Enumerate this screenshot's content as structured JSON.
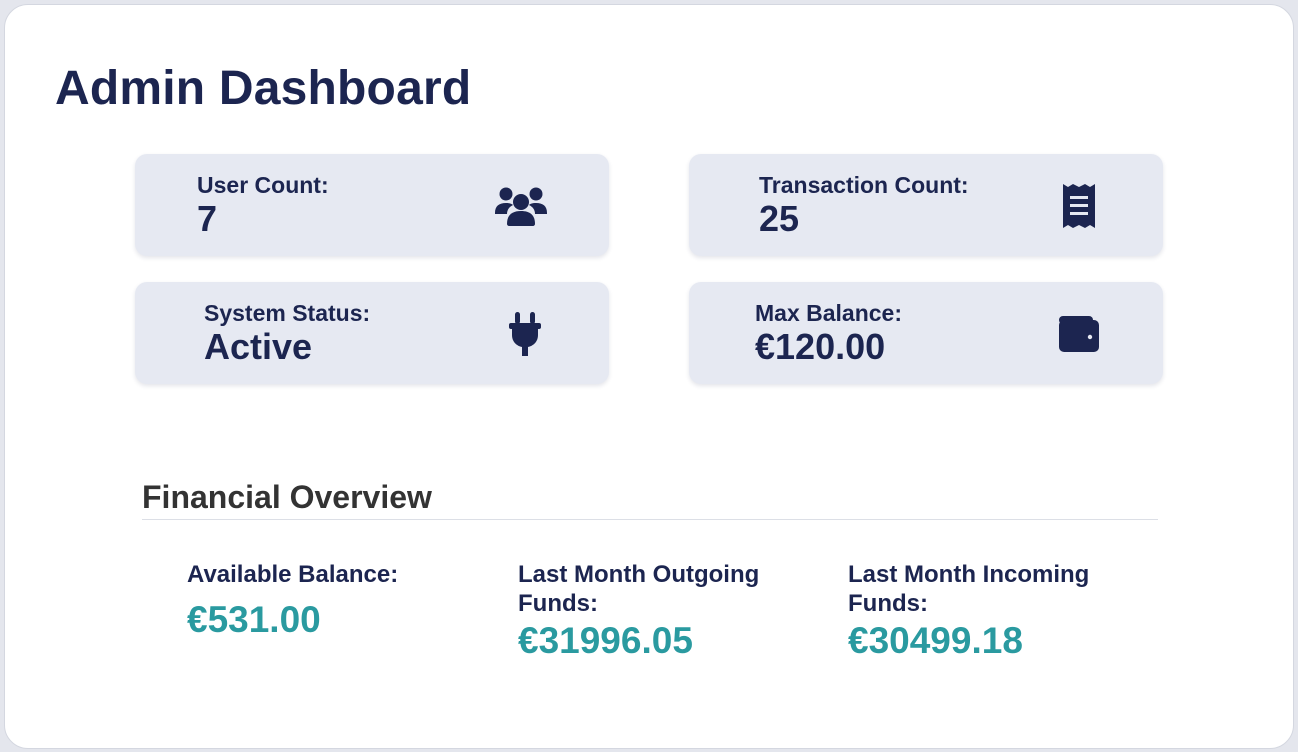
{
  "page": {
    "title": "Admin Dashboard"
  },
  "stats": {
    "user_count": {
      "label": "User Count:",
      "value": "7",
      "icon": "users-icon"
    },
    "transaction_count": {
      "label": "Transaction Count:",
      "value": "25",
      "icon": "receipt-icon"
    },
    "system_status": {
      "label": "System Status:",
      "value": "Active",
      "icon": "plug-icon"
    },
    "max_balance": {
      "label": "Max Balance:",
      "value": "€120.00",
      "icon": "wallet-icon"
    }
  },
  "financial": {
    "title": "Financial Overview",
    "items": [
      {
        "label": "Available Balance:",
        "value": "€531.00"
      },
      {
        "label": "Last Month Outgoing Funds:",
        "value": "€31996.05"
      },
      {
        "label": "Last Month Incoming Funds:",
        "value": "€30499.18"
      }
    ]
  },
  "colors": {
    "primary": "#1c2550",
    "accent": "#2a9aa0",
    "card_bg": "#e6e9f2"
  }
}
